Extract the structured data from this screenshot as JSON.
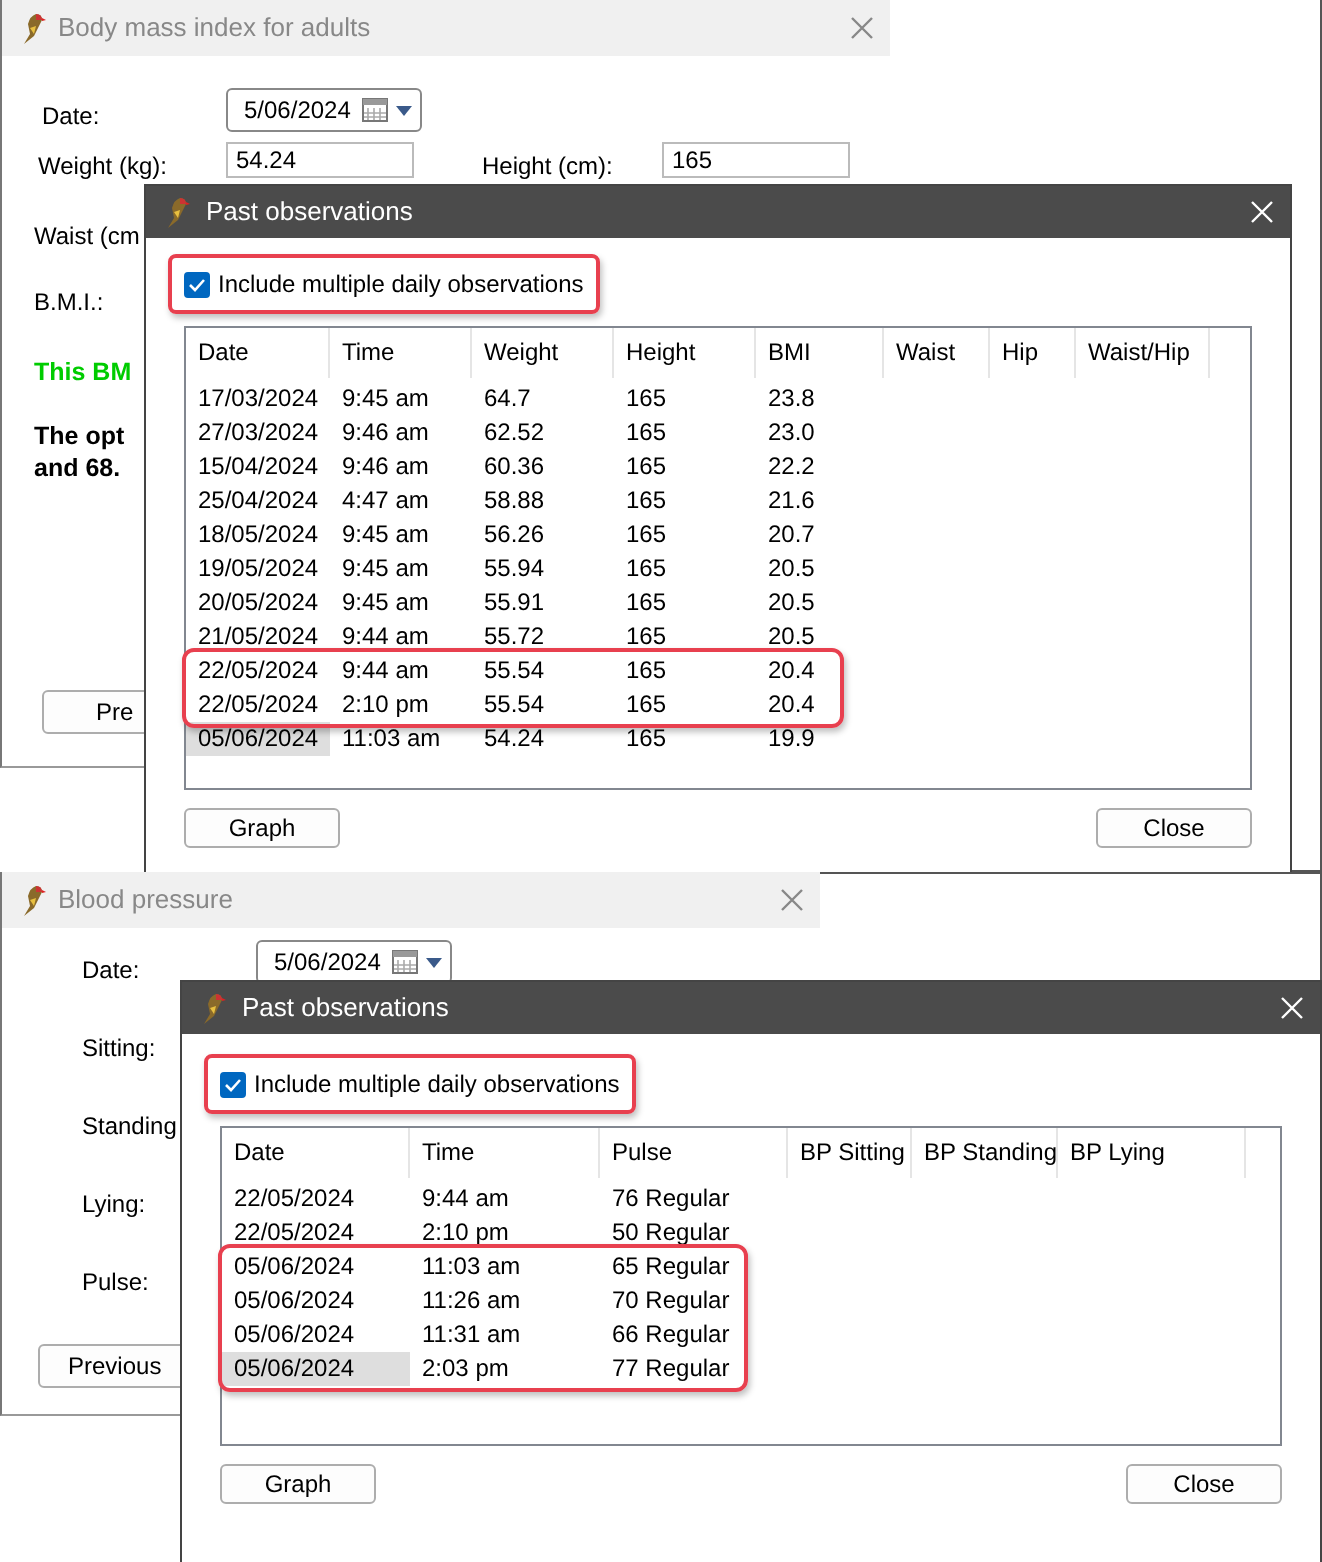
{
  "bmi_window": {
    "title": "Body mass index for adults",
    "date_label": "Date:",
    "date_value": "5/06/2024",
    "weight_label": "Weight (kg):",
    "weight_value": "54.24",
    "height_label": "Height (cm):",
    "height_value": "165",
    "waist_label": "Waist (cm",
    "bmi_label": "B.M.I.:",
    "bmi_message": "This BM",
    "advice_lines": [
      "The opt",
      "and 68."
    ],
    "previous_button": "Pre"
  },
  "bmi_dialog": {
    "title": "Past observations",
    "include_multiple": {
      "label": "Include multiple daily observations",
      "checked": true,
      "highlighted": true
    },
    "table": {
      "columns": [
        "Date",
        "Time",
        "Weight",
        "Height",
        "BMI",
        "Waist",
        "Hip",
        "Waist/Hip"
      ],
      "rows": [
        {
          "cells": [
            "17/03/2024",
            "9:45 am",
            "64.7",
            "165",
            "23.8"
          ],
          "highlighted": false,
          "focused": false
        },
        {
          "cells": [
            "27/03/2024",
            "9:46 am",
            "62.52",
            "165",
            "23.0"
          ],
          "highlighted": false,
          "focused": false
        },
        {
          "cells": [
            "15/04/2024",
            "9:46 am",
            "60.36",
            "165",
            "22.2"
          ],
          "highlighted": false,
          "focused": false
        },
        {
          "cells": [
            "25/04/2024",
            "4:47 am",
            "58.88",
            "165",
            "21.6"
          ],
          "highlighted": false,
          "focused": false
        },
        {
          "cells": [
            "18/05/2024",
            "9:45 am",
            "56.26",
            "165",
            "20.7"
          ],
          "highlighted": false,
          "focused": false
        },
        {
          "cells": [
            "19/05/2024",
            "9:45 am",
            "55.94",
            "165",
            "20.5"
          ],
          "highlighted": false,
          "focused": false
        },
        {
          "cells": [
            "20/05/2024",
            "9:45 am",
            "55.91",
            "165",
            "20.5"
          ],
          "highlighted": false,
          "focused": false
        },
        {
          "cells": [
            "21/05/2024",
            "9:44 am",
            "55.72",
            "165",
            "20.5"
          ],
          "highlighted": false,
          "focused": false
        },
        {
          "cells": [
            "22/05/2024",
            "9:44 am",
            "55.54",
            "165",
            "20.4"
          ],
          "highlighted": true,
          "focused": false
        },
        {
          "cells": [
            "22/05/2024",
            "2:10 pm",
            "55.54",
            "165",
            "20.4"
          ],
          "highlighted": true,
          "focused": false
        },
        {
          "cells": [
            "05/06/2024",
            "11:03 am",
            "54.24",
            "165",
            "19.9"
          ],
          "highlighted": false,
          "focused": true
        }
      ]
    },
    "buttons": [
      "Graph",
      "Close"
    ]
  },
  "bp_window": {
    "title": "Blood pressure",
    "labels": [
      "Date:",
      "Sitting:",
      "Standing",
      "Lying:",
      "Pulse:"
    ],
    "date_value": "5/06/2024",
    "previous_button": "Previous"
  },
  "bp_dialog": {
    "title": "Past observations",
    "include_multiple": {
      "label": "Include multiple daily observations",
      "checked": true,
      "highlighted": true
    },
    "table": {
      "columns": [
        "Date",
        "Time",
        "Pulse",
        "BP Sitting",
        "BP Standing",
        "BP Lying"
      ],
      "rows": [
        {
          "cells": [
            "22/05/2024",
            "9:44 am",
            "76 Regular"
          ],
          "highlighted": false,
          "focused": false
        },
        {
          "cells": [
            "22/05/2024",
            "2:10 pm",
            "50 Regular"
          ],
          "highlighted": false,
          "focused": false
        },
        {
          "cells": [
            "05/06/2024",
            "11:03 am",
            "65 Regular"
          ],
          "highlighted": true,
          "focused": false
        },
        {
          "cells": [
            "05/06/2024",
            "11:26 am",
            "70 Regular"
          ],
          "highlighted": true,
          "focused": false
        },
        {
          "cells": [
            "05/06/2024",
            "11:31 am",
            "66 Regular"
          ],
          "highlighted": true,
          "focused": false
        },
        {
          "cells": [
            "05/06/2024",
            "2:03 pm",
            "77 Regular"
          ],
          "highlighted": true,
          "focused": true
        }
      ]
    },
    "buttons": [
      "Graph",
      "Close"
    ]
  }
}
